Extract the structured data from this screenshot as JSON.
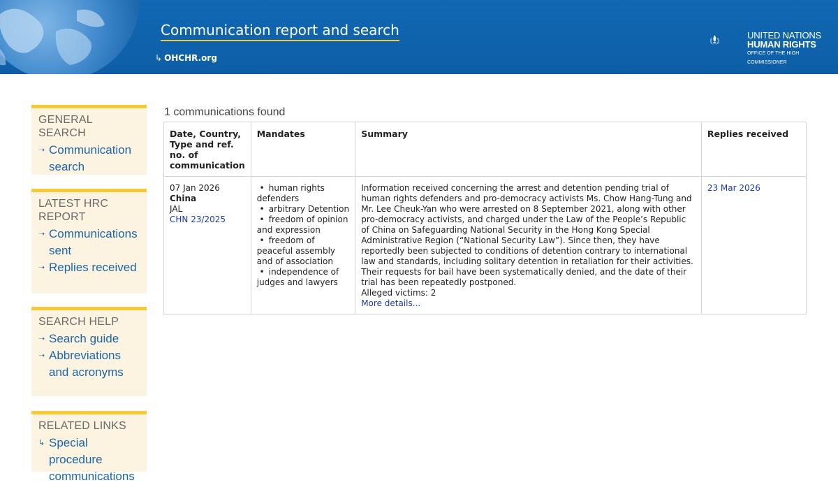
{
  "header": {
    "title": "Communication report and search",
    "home_link": "OHCHR.org",
    "logo": {
      "line1": "UNITED NATIONS",
      "line2": "HUMAN RIGHTS",
      "line3": "OFFICE OF THE HIGH COMMISSIONER"
    }
  },
  "sidebar": {
    "general": {
      "heading": "GENERAL SEARCH",
      "items": [
        "Communication search"
      ]
    },
    "latest": {
      "heading": "LATEST HRC REPORT",
      "items": [
        "Communications sent",
        "Replies received"
      ]
    },
    "help": {
      "heading": "SEARCH HELP",
      "items": [
        "Search guide",
        "Abbreviations and acronyms"
      ]
    },
    "related": {
      "heading": "RELATED LINKS",
      "items": [
        "Special procedure communications"
      ]
    }
  },
  "results": {
    "count_text": "1 communications found",
    "columns": [
      "Date, Country, Type and ref. no. of communication",
      "Mandates",
      "Summary",
      "Replies received"
    ],
    "rows": [
      {
        "date": "07 Jan 2026",
        "country": "China",
        "type": "JAL",
        "ref": "CHN 23/2025",
        "mandates": [
          "human rights defenders",
          "arbitrary Detention",
          "freedom of opinion and expression",
          "freedom of peaceful assembly and of association",
          "independence of judges and lawyers"
        ],
        "summary": "Information received concerning the arrest and detention pending trial of human rights defenders and pro-democracy activists Ms. Chow Hang-Tung and Mr. Lee Cheuk-Yan who were arrested on 8 September 2021, along with other pro-democracy activists, and charged under the Law of the People’s Republic of China on Safeguarding National Security in the Hong Kong Special Administrative Region (“National Security Law”). Since then, they have reportedly been subjected to conditions of detention contrary to international law and standards, including solitary detention in retaliation for their activities. Their requests for bail have been systematically denied, and the date of their trial has been repeatedly postponed.",
        "victims": "Alleged victims: 2",
        "more": "More details...",
        "reply": "23 Mar 2026"
      }
    ]
  },
  "colors": {
    "header_blue": "#0d5ea6",
    "accent_yellow": "#f5ca36",
    "sidebar_bg": "#fdf3e1",
    "link_blue": "#1b67a8"
  }
}
